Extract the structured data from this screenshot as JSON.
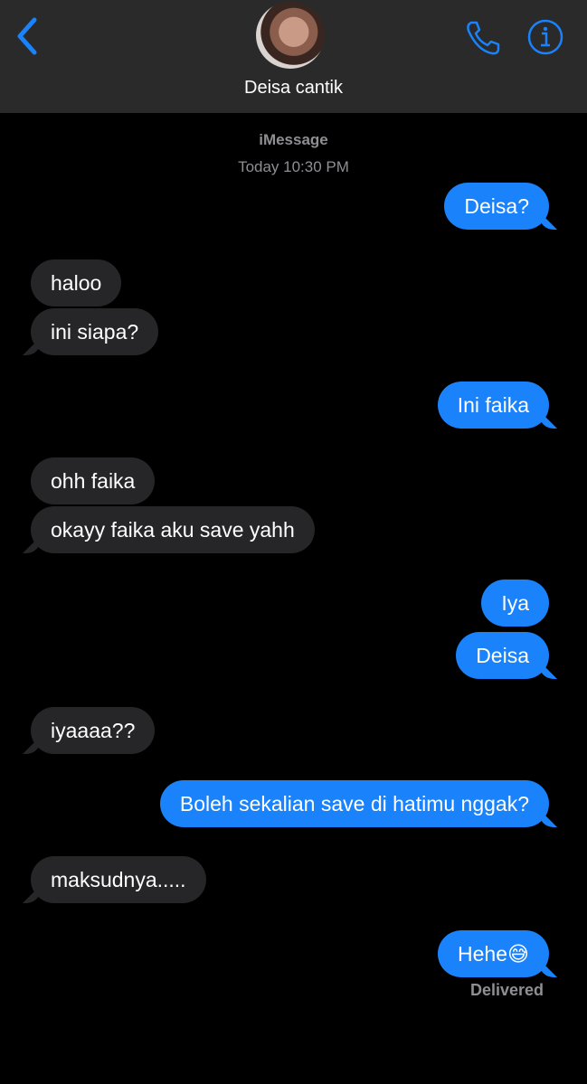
{
  "header": {
    "contact_name": "Deisa cantik",
    "accent_color": "#1a82fb",
    "icons": [
      "chevron-left-icon",
      "avatar",
      "phone-icon",
      "info-icon"
    ]
  },
  "thread": {
    "service": "iMessage",
    "timestamp": "Today 10:30 PM",
    "delivered_status": "Delivered"
  },
  "messages": [
    {
      "from": "me",
      "text": "Deisa?"
    },
    {
      "from": "them",
      "text": "haloo"
    },
    {
      "from": "them",
      "text": "ini siapa?"
    },
    {
      "from": "me",
      "text": "Ini faika"
    },
    {
      "from": "them",
      "text": "ohh faika"
    },
    {
      "from": "them",
      "text": "okayy faika aku save yahh"
    },
    {
      "from": "me",
      "text": "Iya"
    },
    {
      "from": "me",
      "text": "Deisa"
    },
    {
      "from": "them",
      "text": "iyaaaa??"
    },
    {
      "from": "me",
      "text": "Boleh sekalian save di hatimu nggak?"
    },
    {
      "from": "them",
      "text": "maksudnya....."
    },
    {
      "from": "me",
      "text": "Hehe😅"
    }
  ]
}
